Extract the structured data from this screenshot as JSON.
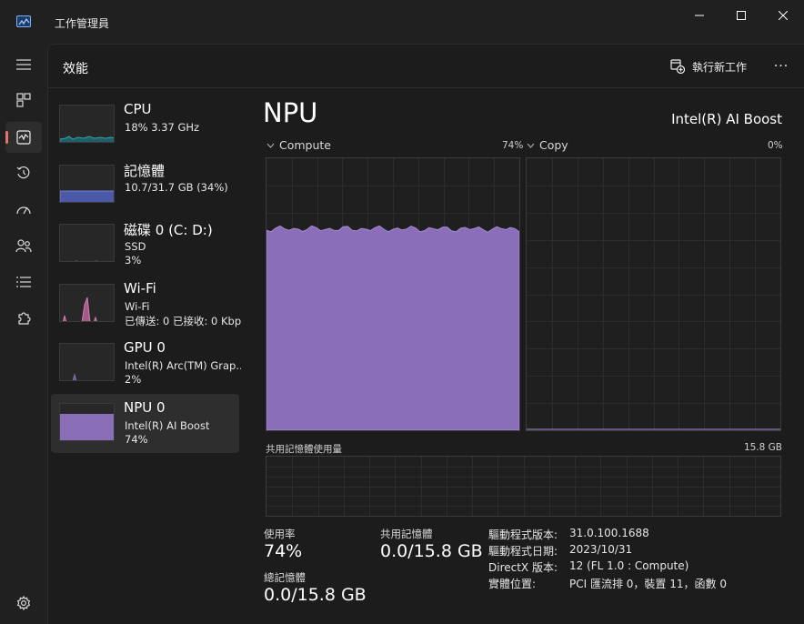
{
  "window": {
    "title": "工作管理員"
  },
  "header": {
    "title": "效能",
    "run_task_label": "執行新工作",
    "more_label": "···"
  },
  "devices": [
    {
      "name": "CPU",
      "sub1": "18%  3.37 GHz",
      "sub2": "",
      "color": "#2fa6b3"
    },
    {
      "name": "記憶體",
      "sub1": "10.7/31.7 GB (34%)",
      "sub2": "",
      "color": "#6f7fd6"
    },
    {
      "name": "磁碟 0 (C: D:)",
      "sub1": "SSD",
      "sub2": "3%",
      "color": "#2fa67a"
    },
    {
      "name": "Wi-Fi",
      "sub1": "Wi-Fi",
      "sub2": "已傳送: 0  已接收: 0 Kbps",
      "color": "#d47fb0"
    },
    {
      "name": "GPU 0",
      "sub1": "Intel(R) Arc(TM) Grap...",
      "sub2": "2%",
      "color": "#8a6fb8"
    },
    {
      "name": "NPU 0",
      "sub1": "Intel(R) AI Boost",
      "sub2": "74%",
      "color": "#8a6fb8"
    }
  ],
  "detail": {
    "title": "NPU",
    "model": "Intel(R) AI Boost",
    "graphs": [
      {
        "label": "Compute",
        "percent": "74%",
        "value": 0.74
      },
      {
        "label": "Copy",
        "percent": "0%",
        "value": 0.0
      }
    ],
    "shared_memory": {
      "label": "共用記憶體使用量",
      "total": "15.8 GB"
    },
    "stats": {
      "utilization_label": "使用率",
      "utilization_value": "74%",
      "shared_label": "共用記憶體",
      "shared_value": "0.0/15.8 GB",
      "total_label": "總記憶體",
      "total_value": "0.0/15.8 GB"
    },
    "info": [
      {
        "key": "驅動程式版本:",
        "value": "31.0.100.1688"
      },
      {
        "key": "驅動程式日期:",
        "value": "2023/10/31"
      },
      {
        "key": "DirectX 版本:",
        "value": "12 (FL 1.0 : Compute)"
      },
      {
        "key": "實體位置:",
        "value": "PCI 匯流排 0，裝置 11，函數 0"
      }
    ]
  },
  "colors": {
    "npu_fill": "#8a6fb8",
    "npu_line": "#a58ad6",
    "accent": "#e3746a"
  }
}
